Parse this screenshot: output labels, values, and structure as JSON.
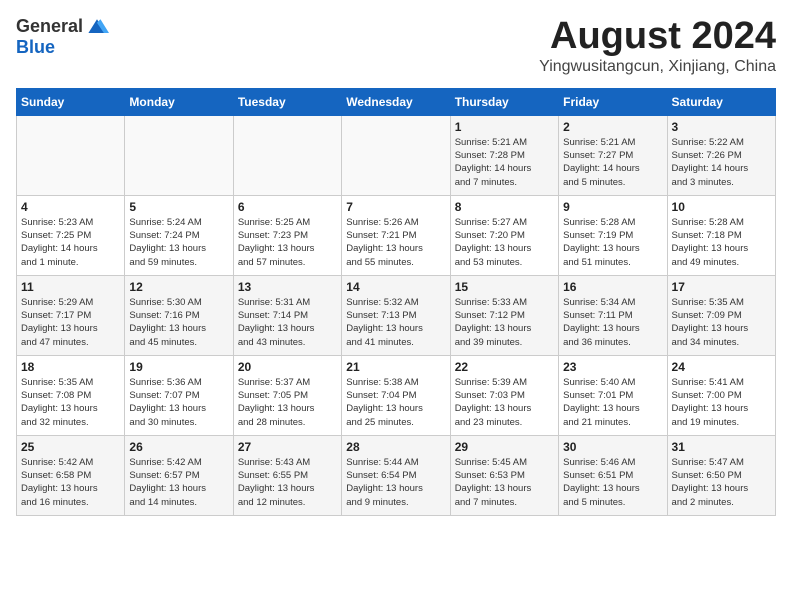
{
  "header": {
    "logo_general": "General",
    "logo_blue": "Blue",
    "month_title": "August 2024",
    "location": "Yingwusitangcun, Xinjiang, China"
  },
  "days_of_week": [
    "Sunday",
    "Monday",
    "Tuesday",
    "Wednesday",
    "Thursday",
    "Friday",
    "Saturday"
  ],
  "weeks": [
    [
      {
        "day": "",
        "info": ""
      },
      {
        "day": "",
        "info": ""
      },
      {
        "day": "",
        "info": ""
      },
      {
        "day": "",
        "info": ""
      },
      {
        "day": "1",
        "info": "Sunrise: 5:21 AM\nSunset: 7:28 PM\nDaylight: 14 hours\nand 7 minutes."
      },
      {
        "day": "2",
        "info": "Sunrise: 5:21 AM\nSunset: 7:27 PM\nDaylight: 14 hours\nand 5 minutes."
      },
      {
        "day": "3",
        "info": "Sunrise: 5:22 AM\nSunset: 7:26 PM\nDaylight: 14 hours\nand 3 minutes."
      }
    ],
    [
      {
        "day": "4",
        "info": "Sunrise: 5:23 AM\nSunset: 7:25 PM\nDaylight: 14 hours\nand 1 minute."
      },
      {
        "day": "5",
        "info": "Sunrise: 5:24 AM\nSunset: 7:24 PM\nDaylight: 13 hours\nand 59 minutes."
      },
      {
        "day": "6",
        "info": "Sunrise: 5:25 AM\nSunset: 7:23 PM\nDaylight: 13 hours\nand 57 minutes."
      },
      {
        "day": "7",
        "info": "Sunrise: 5:26 AM\nSunset: 7:21 PM\nDaylight: 13 hours\nand 55 minutes."
      },
      {
        "day": "8",
        "info": "Sunrise: 5:27 AM\nSunset: 7:20 PM\nDaylight: 13 hours\nand 53 minutes."
      },
      {
        "day": "9",
        "info": "Sunrise: 5:28 AM\nSunset: 7:19 PM\nDaylight: 13 hours\nand 51 minutes."
      },
      {
        "day": "10",
        "info": "Sunrise: 5:28 AM\nSunset: 7:18 PM\nDaylight: 13 hours\nand 49 minutes."
      }
    ],
    [
      {
        "day": "11",
        "info": "Sunrise: 5:29 AM\nSunset: 7:17 PM\nDaylight: 13 hours\nand 47 minutes."
      },
      {
        "day": "12",
        "info": "Sunrise: 5:30 AM\nSunset: 7:16 PM\nDaylight: 13 hours\nand 45 minutes."
      },
      {
        "day": "13",
        "info": "Sunrise: 5:31 AM\nSunset: 7:14 PM\nDaylight: 13 hours\nand 43 minutes."
      },
      {
        "day": "14",
        "info": "Sunrise: 5:32 AM\nSunset: 7:13 PM\nDaylight: 13 hours\nand 41 minutes."
      },
      {
        "day": "15",
        "info": "Sunrise: 5:33 AM\nSunset: 7:12 PM\nDaylight: 13 hours\nand 39 minutes."
      },
      {
        "day": "16",
        "info": "Sunrise: 5:34 AM\nSunset: 7:11 PM\nDaylight: 13 hours\nand 36 minutes."
      },
      {
        "day": "17",
        "info": "Sunrise: 5:35 AM\nSunset: 7:09 PM\nDaylight: 13 hours\nand 34 minutes."
      }
    ],
    [
      {
        "day": "18",
        "info": "Sunrise: 5:35 AM\nSunset: 7:08 PM\nDaylight: 13 hours\nand 32 minutes."
      },
      {
        "day": "19",
        "info": "Sunrise: 5:36 AM\nSunset: 7:07 PM\nDaylight: 13 hours\nand 30 minutes."
      },
      {
        "day": "20",
        "info": "Sunrise: 5:37 AM\nSunset: 7:05 PM\nDaylight: 13 hours\nand 28 minutes."
      },
      {
        "day": "21",
        "info": "Sunrise: 5:38 AM\nSunset: 7:04 PM\nDaylight: 13 hours\nand 25 minutes."
      },
      {
        "day": "22",
        "info": "Sunrise: 5:39 AM\nSunset: 7:03 PM\nDaylight: 13 hours\nand 23 minutes."
      },
      {
        "day": "23",
        "info": "Sunrise: 5:40 AM\nSunset: 7:01 PM\nDaylight: 13 hours\nand 21 minutes."
      },
      {
        "day": "24",
        "info": "Sunrise: 5:41 AM\nSunset: 7:00 PM\nDaylight: 13 hours\nand 19 minutes."
      }
    ],
    [
      {
        "day": "25",
        "info": "Sunrise: 5:42 AM\nSunset: 6:58 PM\nDaylight: 13 hours\nand 16 minutes."
      },
      {
        "day": "26",
        "info": "Sunrise: 5:42 AM\nSunset: 6:57 PM\nDaylight: 13 hours\nand 14 minutes."
      },
      {
        "day": "27",
        "info": "Sunrise: 5:43 AM\nSunset: 6:55 PM\nDaylight: 13 hours\nand 12 minutes."
      },
      {
        "day": "28",
        "info": "Sunrise: 5:44 AM\nSunset: 6:54 PM\nDaylight: 13 hours\nand 9 minutes."
      },
      {
        "day": "29",
        "info": "Sunrise: 5:45 AM\nSunset: 6:53 PM\nDaylight: 13 hours\nand 7 minutes."
      },
      {
        "day": "30",
        "info": "Sunrise: 5:46 AM\nSunset: 6:51 PM\nDaylight: 13 hours\nand 5 minutes."
      },
      {
        "day": "31",
        "info": "Sunrise: 5:47 AM\nSunset: 6:50 PM\nDaylight: 13 hours\nand 2 minutes."
      }
    ]
  ]
}
